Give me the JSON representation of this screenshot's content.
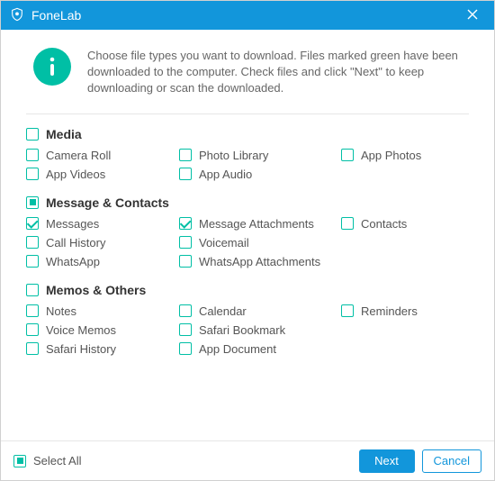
{
  "titlebar": {
    "title": "FoneLab"
  },
  "intro": {
    "text": "Choose file types you want to download. Files marked green have been downloaded to the computer. Check files and click \"Next\" to keep downloading or scan the downloaded."
  },
  "sections": {
    "media": {
      "title": "Media",
      "state": "unchecked",
      "items": [
        {
          "label": "Camera Roll",
          "checked": false
        },
        {
          "label": "Photo Library",
          "checked": false
        },
        {
          "label": "App Photos",
          "checked": false
        },
        {
          "label": "App Videos",
          "checked": false
        },
        {
          "label": "App Audio",
          "checked": false
        }
      ]
    },
    "messages": {
      "title": "Message & Contacts",
      "state": "indeterminate",
      "items": [
        {
          "label": "Messages",
          "checked": true
        },
        {
          "label": "Message Attachments",
          "checked": true
        },
        {
          "label": "Contacts",
          "checked": false
        },
        {
          "label": "Call History",
          "checked": false
        },
        {
          "label": "Voicemail",
          "checked": false
        },
        {
          "label": "",
          "checked": null
        },
        {
          "label": "WhatsApp",
          "checked": false
        },
        {
          "label": "WhatsApp Attachments",
          "checked": false
        }
      ]
    },
    "memos": {
      "title": "Memos & Others",
      "state": "unchecked",
      "items": [
        {
          "label": "Notes",
          "checked": false
        },
        {
          "label": "Calendar",
          "checked": false
        },
        {
          "label": "Reminders",
          "checked": false
        },
        {
          "label": "Voice Memos",
          "checked": false
        },
        {
          "label": "Safari Bookmark",
          "checked": false
        },
        {
          "label": "",
          "checked": null
        },
        {
          "label": "Safari History",
          "checked": false
        },
        {
          "label": "App Document",
          "checked": false
        }
      ]
    }
  },
  "footer": {
    "select_all": {
      "label": "Select All",
      "state": "indeterminate"
    },
    "next": "Next",
    "cancel": "Cancel"
  },
  "colors": {
    "accent_blue": "#1296db",
    "accent_teal": "#00bfa5"
  }
}
